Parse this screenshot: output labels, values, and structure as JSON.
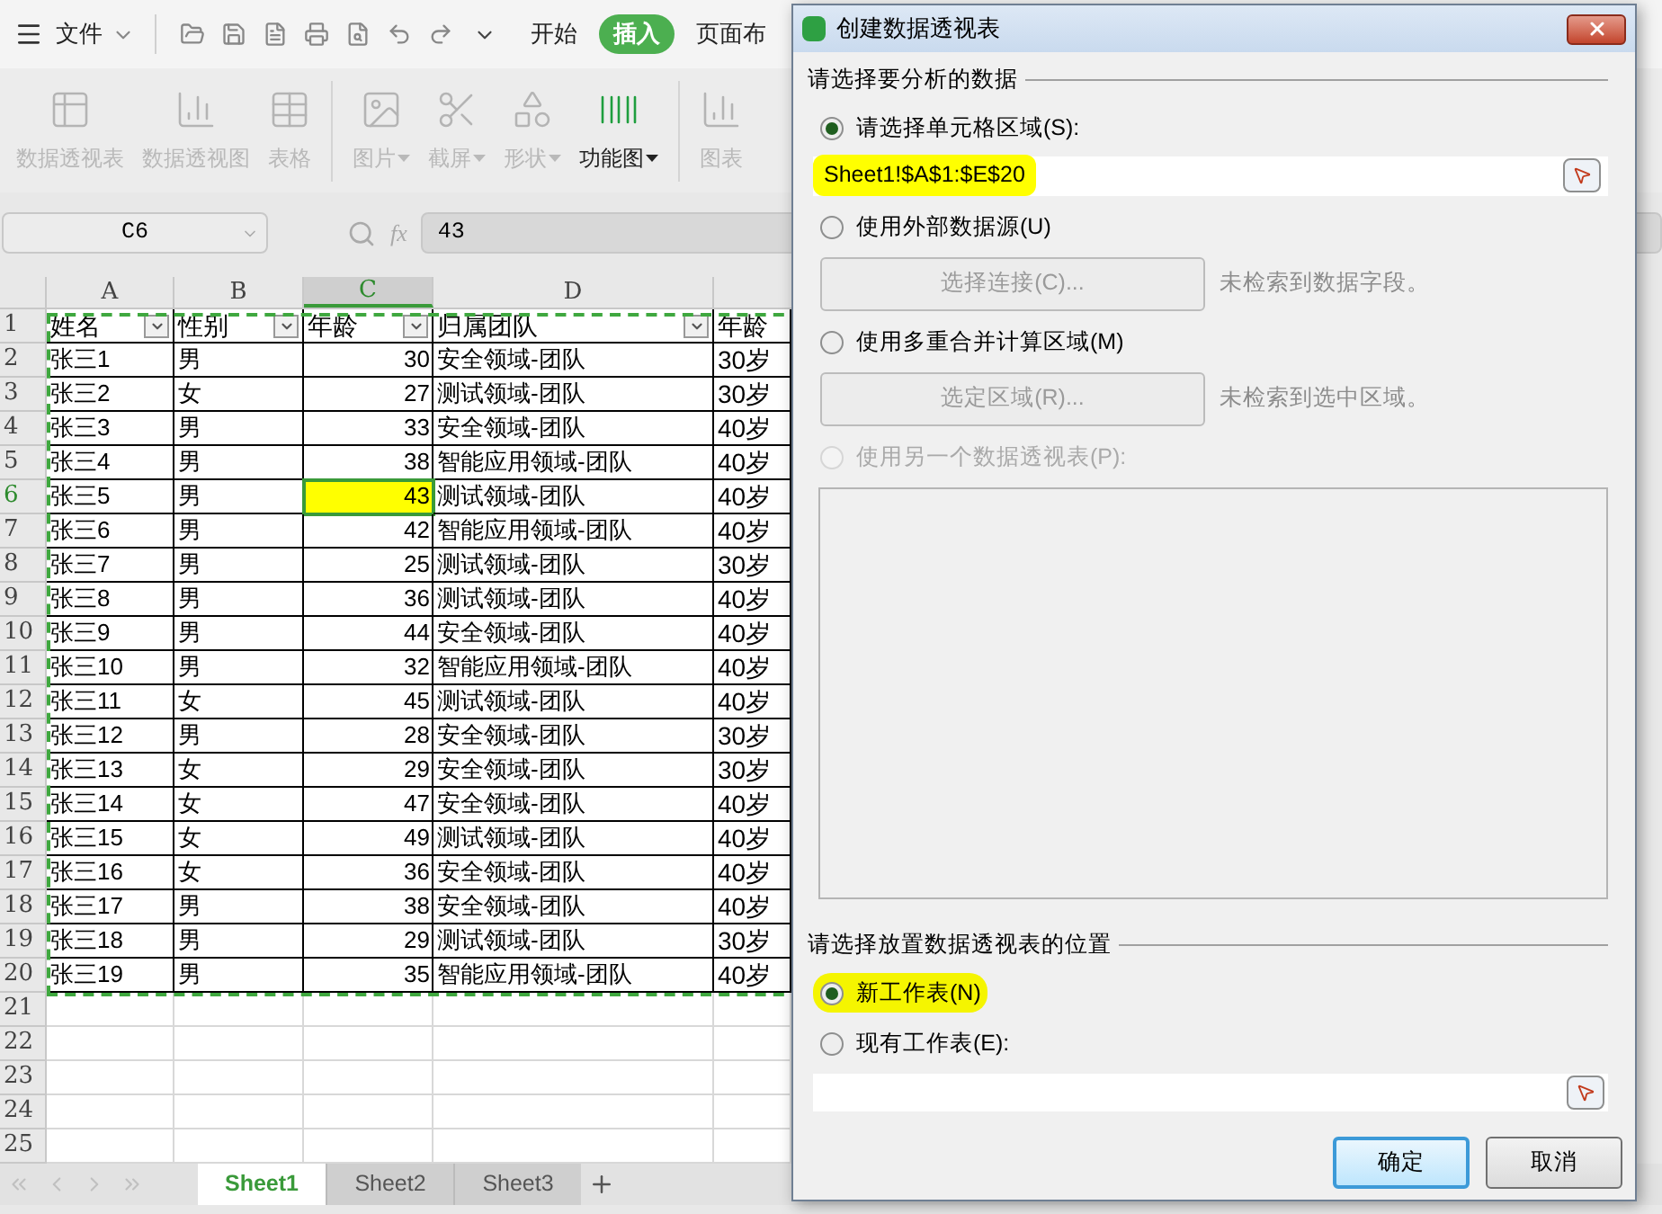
{
  "toolbar": {
    "menu": "文件",
    "tabs": [
      {
        "label": "开始",
        "selected": false
      },
      {
        "label": "插入",
        "selected": true
      },
      {
        "label": "页面布",
        "selected": false
      }
    ]
  },
  "ribbon": [
    [
      {
        "label": "数据透视表",
        "disabled": true,
        "dropdown": false
      },
      {
        "label": "数据透视图",
        "disabled": true,
        "dropdown": false
      },
      {
        "label": "表格",
        "disabled": true,
        "dropdown": false
      }
    ],
    [
      {
        "label": "图片",
        "disabled": true,
        "dropdown": true
      },
      {
        "label": "截屏",
        "disabled": true,
        "dropdown": true
      },
      {
        "label": "形状",
        "disabled": true,
        "dropdown": true
      },
      {
        "label": "功能图",
        "disabled": false,
        "dropdown": true
      }
    ],
    [
      {
        "label": "图表",
        "disabled": true,
        "dropdown": false
      }
    ]
  ],
  "formula_bar": {
    "cell_ref": "C6",
    "fx_label": "fx",
    "value": "43"
  },
  "sheet": {
    "copy_range": true,
    "active_cell_highlighted": true,
    "columns": [
      {
        "label": "A",
        "selected": false
      },
      {
        "label": "B",
        "selected": false
      },
      {
        "label": "C",
        "selected": true
      },
      {
        "label": "D",
        "selected": false
      }
    ],
    "rows": [
      {
        "label": "1",
        "selected": false,
        "kind": "header",
        "cells": [
          "姓名",
          "性别",
          "年龄",
          "归属团队",
          "年龄"
        ]
      },
      {
        "label": "2",
        "selected": false,
        "kind": "data",
        "cells": [
          "张三1",
          "男",
          "30",
          "安全领域-团队",
          "30岁"
        ]
      },
      {
        "label": "3",
        "selected": false,
        "kind": "data",
        "cells": [
          "张三2",
          "女",
          "27",
          "测试领域-团队",
          "30岁"
        ]
      },
      {
        "label": "4",
        "selected": false,
        "kind": "data",
        "cells": [
          "张三3",
          "男",
          "33",
          "安全领域-团队",
          "40岁"
        ]
      },
      {
        "label": "5",
        "selected": false,
        "kind": "data",
        "cells": [
          "张三4",
          "男",
          "38",
          "智能应用领域-团队",
          "40岁"
        ]
      },
      {
        "label": "6",
        "selected": true,
        "kind": "data",
        "cells": [
          "张三5",
          "男",
          "43",
          "测试领域-团队",
          "40岁"
        ]
      },
      {
        "label": "7",
        "selected": false,
        "kind": "data",
        "cells": [
          "张三6",
          "男",
          "42",
          "智能应用领域-团队",
          "40岁"
        ]
      },
      {
        "label": "8",
        "selected": false,
        "kind": "data",
        "cells": [
          "张三7",
          "男",
          "25",
          "测试领域-团队",
          "30岁"
        ]
      },
      {
        "label": "9",
        "selected": false,
        "kind": "data",
        "cells": [
          "张三8",
          "男",
          "36",
          "测试领域-团队",
          "40岁"
        ]
      },
      {
        "label": "10",
        "selected": false,
        "kind": "data",
        "cells": [
          "张三9",
          "男",
          "44",
          "安全领域-团队",
          "40岁"
        ]
      },
      {
        "label": "11",
        "selected": false,
        "kind": "data",
        "cells": [
          "张三10",
          "男",
          "32",
          "智能应用领域-团队",
          "40岁"
        ]
      },
      {
        "label": "12",
        "selected": false,
        "kind": "data",
        "cells": [
          "张三11",
          "女",
          "45",
          "测试领域-团队",
          "40岁"
        ]
      },
      {
        "label": "13",
        "selected": false,
        "kind": "data",
        "cells": [
          "张三12",
          "男",
          "28",
          "安全领域-团队",
          "30岁"
        ]
      },
      {
        "label": "14",
        "selected": false,
        "kind": "data",
        "cells": [
          "张三13",
          "女",
          "29",
          "安全领域-团队",
          "30岁"
        ]
      },
      {
        "label": "15",
        "selected": false,
        "kind": "data",
        "cells": [
          "张三14",
          "女",
          "47",
          "安全领域-团队",
          "40岁"
        ]
      },
      {
        "label": "16",
        "selected": false,
        "kind": "data",
        "cells": [
          "张三15",
          "女",
          "49",
          "测试领域-团队",
          "40岁"
        ]
      },
      {
        "label": "17",
        "selected": false,
        "kind": "data",
        "cells": [
          "张三16",
          "女",
          "36",
          "安全领域-团队",
          "40岁"
        ]
      },
      {
        "label": "18",
        "selected": false,
        "kind": "data",
        "cells": [
          "张三17",
          "男",
          "38",
          "安全领域-团队",
          "40岁"
        ]
      },
      {
        "label": "19",
        "selected": false,
        "kind": "data",
        "cells": [
          "张三18",
          "男",
          "29",
          "测试领域-团队",
          "30岁"
        ]
      },
      {
        "label": "20",
        "selected": false,
        "kind": "data",
        "cells": [
          "张三19",
          "男",
          "35",
          "智能应用领域-团队",
          "40岁"
        ]
      },
      {
        "label": "21",
        "selected": false,
        "kind": "empty"
      },
      {
        "label": "22",
        "selected": false,
        "kind": "empty"
      },
      {
        "label": "23",
        "selected": false,
        "kind": "empty"
      },
      {
        "label": "24",
        "selected": false,
        "kind": "empty"
      },
      {
        "label": "25",
        "selected": false,
        "kind": "empty"
      }
    ]
  },
  "sheet_tabs": [
    {
      "label": "Sheet1",
      "selected": true
    },
    {
      "label": "Sheet2",
      "selected": false
    },
    {
      "label": "Sheet3",
      "selected": false
    }
  ],
  "dialog": {
    "title": "创建数据透视表",
    "source_legend": "请选择要分析的数据",
    "source_options": [
      {
        "label": "请选择单元格区域(S):",
        "selected": true,
        "disabled": false,
        "kind": "range",
        "value": "Sheet1!$A$1:$E$20",
        "highlighted": true
      },
      {
        "label": "使用外部数据源(U)",
        "selected": false,
        "disabled": false,
        "kind": "button",
        "button": "选择连接(C)...",
        "note": "未检索到数据字段。"
      },
      {
        "label": "使用多重合并计算区域(M)",
        "selected": false,
        "disabled": false,
        "kind": "button",
        "button": "选定区域(R)...",
        "note": "未检索到选中区域。"
      },
      {
        "label": "使用另一个数据透视表(P):",
        "selected": false,
        "disabled": true,
        "kind": "list"
      }
    ],
    "dest_legend": "请选择放置数据透视表的位置",
    "dest_options": [
      {
        "label": "新工作表(N)",
        "selected": true,
        "disabled": false,
        "kind": "plain",
        "highlighted": true
      },
      {
        "label": "现有工作表(E):",
        "selected": false,
        "disabled": false,
        "kind": "range",
        "highlighted": false
      }
    ],
    "buttons": [
      {
        "label": "确定",
        "default": true
      },
      {
        "label": "取消",
        "default": false
      }
    ]
  }
}
